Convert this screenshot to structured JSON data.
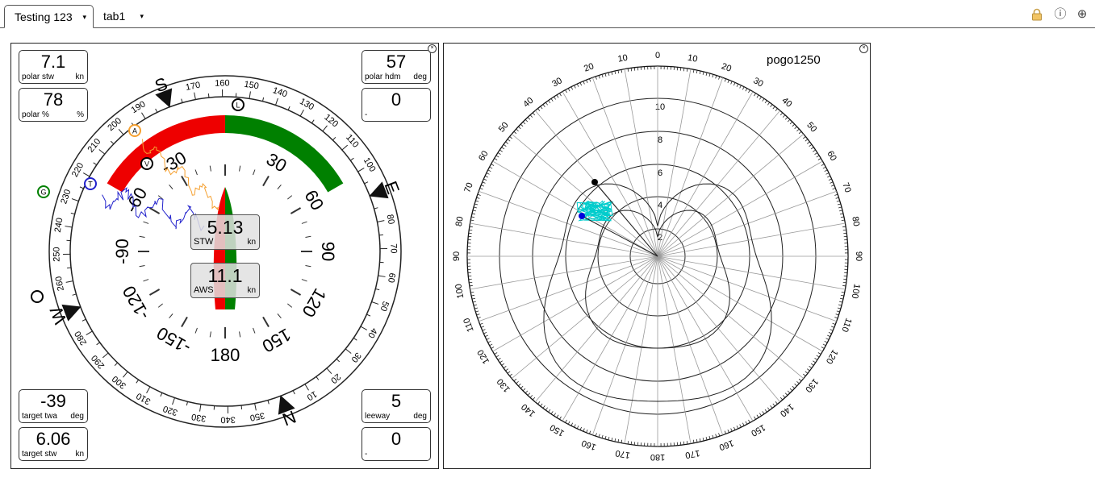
{
  "tabs": [
    {
      "label": "Testing 123",
      "caret": "▾"
    },
    {
      "label": "tab1",
      "caret": "▾"
    }
  ],
  "toolbar": {
    "lock_icon": "lock-icon",
    "info_icon": "info-icon",
    "add_icon": "add-icon"
  },
  "compass": {
    "boxes": {
      "polar_stw": {
        "value": "7.1",
        "label": "polar stw",
        "unit": "kn"
      },
      "polar_pct": {
        "value": "78",
        "label": "polar %",
        "unit": "%"
      },
      "polar_hdm": {
        "value": "57",
        "label": "polar hdm",
        "unit": "deg"
      },
      "blank_top": {
        "value": "0",
        "label": "-",
        "unit": ""
      },
      "target_twa": {
        "value": "-39",
        "label": "target twa",
        "unit": "deg"
      },
      "target_stw": {
        "value": "6.06",
        "label": "target stw",
        "unit": "kn"
      },
      "leeway": {
        "value": "5",
        "label": "leeway",
        "unit": "deg"
      },
      "blank_bottom": {
        "value": "0",
        "label": "-",
        "unit": ""
      }
    },
    "stw": {
      "value": "5.13",
      "label": "STW",
      "unit": "kn"
    },
    "aws": {
      "value": "11.1",
      "label": "AWS",
      "unit": "kn"
    },
    "cardinals": {
      "N": "N",
      "E": "E",
      "S": "S",
      "W": "W"
    },
    "markers": {
      "A": "A",
      "V": "V",
      "T": "T",
      "G": "G",
      "L": "L"
    },
    "colors": {
      "port": "#ee0000",
      "starboard": "#008000",
      "apparent": "#f5a030",
      "true": "#2222cc"
    }
  },
  "polar": {
    "title": "pogo1250",
    "rings": [
      "2",
      "4",
      "6",
      "8",
      "10"
    ],
    "colors": {
      "trace": "#00cccc",
      "point": "#0000dd"
    }
  }
}
